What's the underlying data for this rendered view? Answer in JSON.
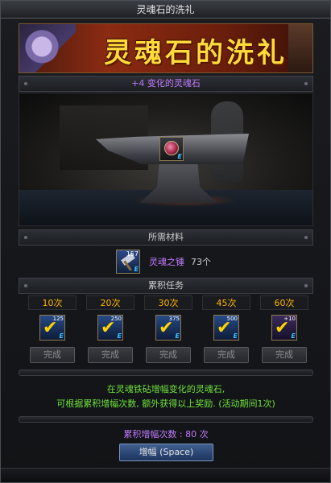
{
  "window": {
    "title": "灵魂石的洗礼"
  },
  "banner": {
    "title": "灵魂石的洗礼"
  },
  "item_bar": {
    "label": "+4 变化的灵魂石"
  },
  "materials": {
    "header": "所需材料",
    "item": {
      "name": "灵魂之锤",
      "quantity": "73个",
      "stack": "157",
      "icon": "hammer-icon"
    }
  },
  "tasks": {
    "header": "累积任务",
    "items": [
      {
        "label": "10次",
        "icon_num": "125",
        "button": "完成"
      },
      {
        "label": "20次",
        "icon_num": "250",
        "button": "完成"
      },
      {
        "label": "30次",
        "icon_num": "375",
        "button": "完成"
      },
      {
        "label": "45次",
        "icon_num": "500",
        "button": "完成"
      },
      {
        "label": "60次",
        "icon_num": "+10",
        "button": "完成"
      }
    ]
  },
  "description": {
    "line1": "在灵魂铁砧增幅变化的灵魂石,",
    "line2": "可根据累积增幅次数, 额外获得以上奖励. (活动期间1次)"
  },
  "total": "累积增幅次数 : 80 次",
  "button": {
    "label": "增幅 (Space)"
  },
  "colors": {
    "accent_yellow": "#ffd93a",
    "purple": "#c27bff",
    "green": "#6fe23c",
    "orange": "#ffb400"
  }
}
